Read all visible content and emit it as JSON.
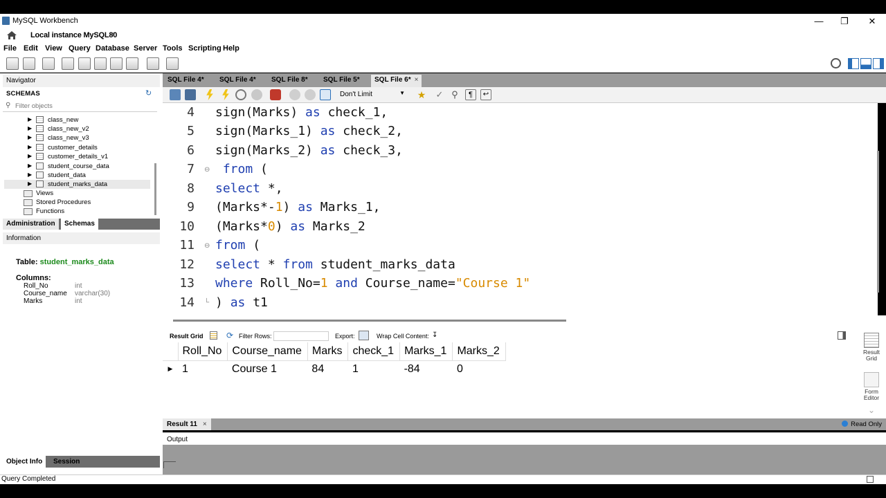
{
  "window": {
    "title": "MySQL Workbench"
  },
  "instance_tab": {
    "label": "Local instance MySQL80",
    "close": "×"
  },
  "menu": [
    "File",
    "Edit",
    "View",
    "Query",
    "Database",
    "Server",
    "Tools",
    "Scripting",
    "Help"
  ],
  "navigator": {
    "header": "Navigator",
    "schemas_label": "SCHEMAS",
    "filter_placeholder": "Filter objects",
    "tables": [
      "class_new",
      "class_new_v2",
      "class_new_v3",
      "customer_details",
      "customer_details_v1",
      "student_course_data",
      "student_data",
      "student_marks_data"
    ],
    "selected_table": "student_marks_data",
    "folders": [
      "Views",
      "Stored Procedures",
      "Functions"
    ],
    "tabs": [
      "Administration",
      "Schemas"
    ]
  },
  "information": {
    "header": "Information",
    "table_label": "Table:",
    "table_name": "student_marks_data",
    "columns_label": "Columns:",
    "columns": [
      {
        "name": "Roll_No",
        "type": "int"
      },
      {
        "name": "Course_name",
        "type": "varchar(30)"
      },
      {
        "name": "Marks",
        "type": "int"
      }
    ]
  },
  "bottom_tabs": [
    "Object Info",
    "Session"
  ],
  "status": {
    "text": "Query Completed"
  },
  "editor_tabs": [
    "SQL File 4*",
    "SQL File 4*",
    "SQL File 8*",
    "SQL File 5*",
    "SQL File 6*"
  ],
  "active_editor_tab": 4,
  "sql_toolbar": {
    "limit": "Don't Limit"
  },
  "code": {
    "line_numbers": [
      "4",
      "5",
      "6",
      "7",
      "8",
      "9",
      "10",
      "11",
      "12",
      "13",
      "14"
    ]
  },
  "result_toolbar": {
    "result_grid": "Result Grid",
    "filter_rows": "Filter Rows:",
    "export": "Export:",
    "wrap": "Wrap Cell Content:"
  },
  "result_grid": {
    "columns": [
      "Roll_No",
      "Course_name",
      "Marks",
      "check_1",
      "Marks_1",
      "Marks_2"
    ],
    "rows": [
      [
        "1",
        "Course 1",
        "84",
        "1",
        "-84",
        "0"
      ]
    ]
  },
  "result_side": {
    "grid_label": "Result Grid",
    "form_label": "Form Editor"
  },
  "result_tab": {
    "label": "Result 11",
    "close": "×",
    "readonly": "Read Only"
  },
  "output": {
    "label": "Output"
  },
  "colors": {
    "keyword": "#1f3fb0",
    "number": "#d88a00",
    "tab_bar": "#9a9a9a",
    "schema_green": "#1c8a1c"
  }
}
